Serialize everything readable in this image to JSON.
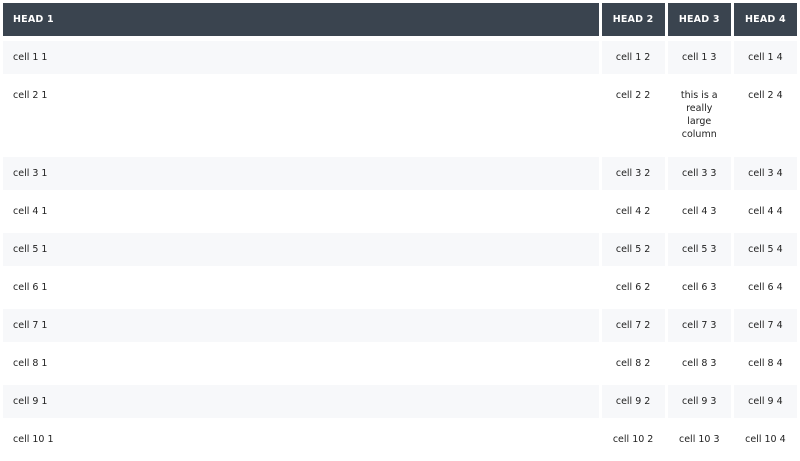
{
  "headers": [
    "HEAD 1",
    "HEAD 2",
    "HEAD 3",
    "HEAD 4"
  ],
  "rows": [
    [
      "cell 1 1",
      "cell 1 2",
      "cell 1 3",
      "cell 1 4"
    ],
    [
      "cell 2 1",
      "cell 2 2",
      "this is a really large column",
      "cell 2 4"
    ],
    [
      "cell 3 1",
      "cell 3 2",
      "cell 3 3",
      "cell 3 4"
    ],
    [
      "cell 4 1",
      "cell 4 2",
      "cell 4 3",
      "cell 4 4"
    ],
    [
      "cell 5 1",
      "cell 5 2",
      "cell 5 3",
      "cell 5 4"
    ],
    [
      "cell 6 1",
      "cell 6 2",
      "cell 6 3",
      "cell 6 4"
    ],
    [
      "cell 7 1",
      "cell 7 2",
      "cell 7 3",
      "cell 7 4"
    ],
    [
      "cell 8 1",
      "cell 8 2",
      "cell 8 3",
      "cell 8 4"
    ],
    [
      "cell 9 1",
      "cell 9 2",
      "cell 9 3",
      "cell 9 4"
    ],
    [
      "cell 10 1",
      "cell 10 2",
      "cell 10 3",
      "cell 10 4"
    ]
  ]
}
